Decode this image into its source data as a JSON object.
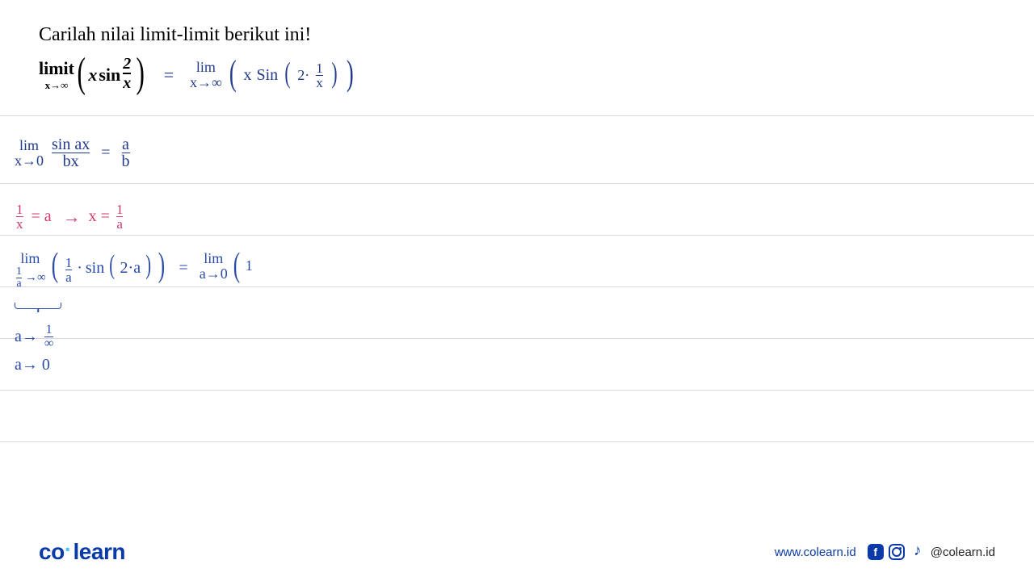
{
  "title": "Carilah nilai limit-limit berikut ini!",
  "printed": {
    "limit_label": "limit",
    "limit_sub": "x→∞",
    "body_left": "x",
    "body_sin": "sin",
    "frac_num": "2",
    "frac_den": "x"
  },
  "hand_header": {
    "lim": "lim",
    "sub": "x→∞",
    "inner_x": "x",
    "inner_sin": "Sin",
    "inner_2": "2·",
    "frac_num": "1",
    "frac_den": "x"
  },
  "step1": {
    "lim": "lim",
    "sub": "x→0",
    "frac1_num": "sin ax",
    "frac1_den": "bx",
    "eq": "=",
    "frac2_num": "a",
    "frac2_den": "b"
  },
  "step2": {
    "lhs_num": "1",
    "lhs_den": "x",
    "eq1": "= a",
    "arrow": "→",
    "rhs": "x =",
    "rhs_frac_num": "1",
    "rhs_frac_den": "a"
  },
  "step3": {
    "lim": "lim",
    "sub_num": "1",
    "sub_den": "a",
    "sub_arrow": "→∞",
    "body_frac_num": "1",
    "body_frac_den": "a",
    "body_dot": "·",
    "body_sin": "sin",
    "body_inner": "2·a",
    "eq": "=",
    "rhs_lim": "lim",
    "rhs_sub": "a→0",
    "rhs_paren": "1"
  },
  "step4a": {
    "text_pre": "a→",
    "frac_num": "1",
    "frac_den": "∞"
  },
  "step4b": {
    "text": "a→ 0"
  },
  "footer": {
    "logo_co": "co",
    "logo_learn": "learn",
    "url": "www.colearn.id",
    "handle": "@colearn.id",
    "fb": "f"
  }
}
